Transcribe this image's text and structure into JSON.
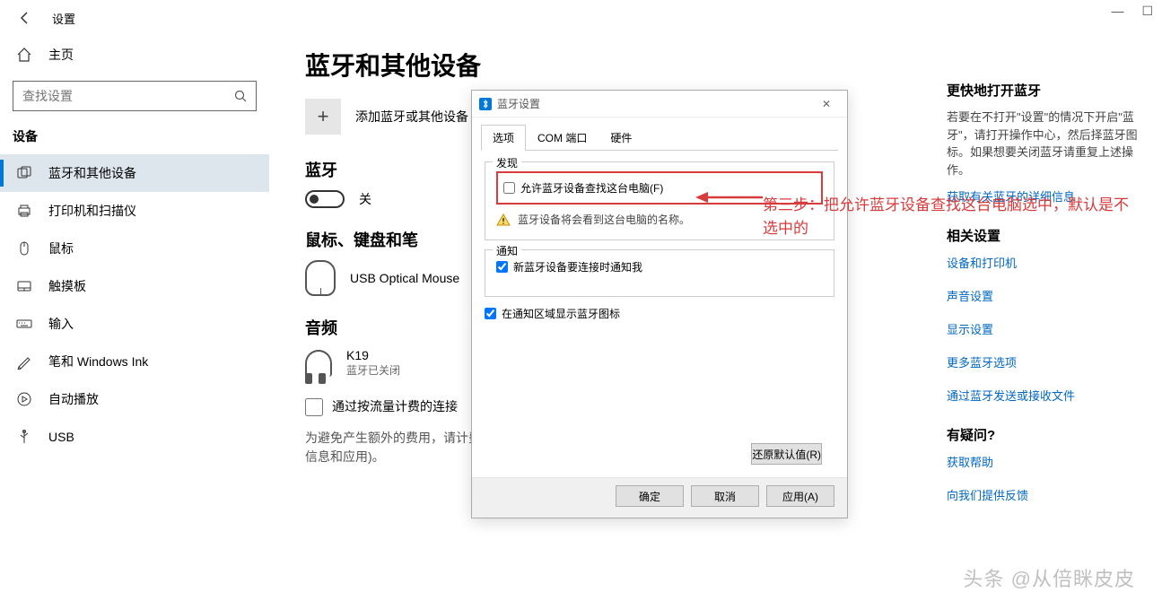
{
  "titlebar": {
    "title": "设置"
  },
  "sidebar": {
    "home": "主页",
    "search_placeholder": "查找设置",
    "category": "设备",
    "items": [
      {
        "label": "蓝牙和其他设备"
      },
      {
        "label": "打印机和扫描仪"
      },
      {
        "label": "鼠标"
      },
      {
        "label": "触摸板"
      },
      {
        "label": "输入"
      },
      {
        "label": "笔和 Windows Ink"
      },
      {
        "label": "自动播放"
      },
      {
        "label": "USB"
      }
    ]
  },
  "main": {
    "title": "蓝牙和其他设备",
    "add_label": "添加蓝牙或其他设备",
    "bt_heading": "蓝牙",
    "bt_state": "关",
    "mouse_heading": "鼠标、键盘和笔",
    "mouse_name": "USB Optical Mouse",
    "audio_heading": "音频",
    "audio_name": "K19",
    "audio_sub": "蓝牙已关闭",
    "metered_check": "通过按流量计费的连接",
    "metered_desc": "为避免产生额外的费用，请计费的 Internet 连接时，就程序、信息和应用)。"
  },
  "dialog": {
    "title": "蓝牙设置",
    "tabs": [
      "选项",
      "COM 端口",
      "硬件"
    ],
    "group_discover": "发现",
    "allow_find": "允许蓝牙设备查找这台电脑(F)",
    "find_info": "蓝牙设备将会看到这台电脑的名称。",
    "group_notify": "通知",
    "notify_connect": "新蓝牙设备要连接时通知我",
    "tray_icon": "在通知区域显示蓝牙图标",
    "restore_defaults": "还原默认值(R)",
    "ok": "确定",
    "cancel": "取消",
    "apply": "应用(A)"
  },
  "annotation": {
    "text": "第三步：把允许蓝牙设备查找这台电脑选中，默认是不选中的"
  },
  "right": {
    "h1": "更快地打开蓝牙",
    "p1": "若要在不打开\"设置\"的情况下开启\"蓝牙\"，请打开操作中心，然后择蓝牙图标。如果想要关闭蓝牙请重复上述操作。",
    "link1": "获取有关蓝牙的详细信息",
    "h2": "相关设置",
    "links2": [
      "设备和打印机",
      "声音设置",
      "显示设置",
      "更多蓝牙选项",
      "通过蓝牙发送或接收文件"
    ],
    "h3": "有疑问?",
    "link3": "获取帮助",
    "link4": "向我们提供反馈"
  },
  "watermark": "头条 @从倍眯皮皮"
}
